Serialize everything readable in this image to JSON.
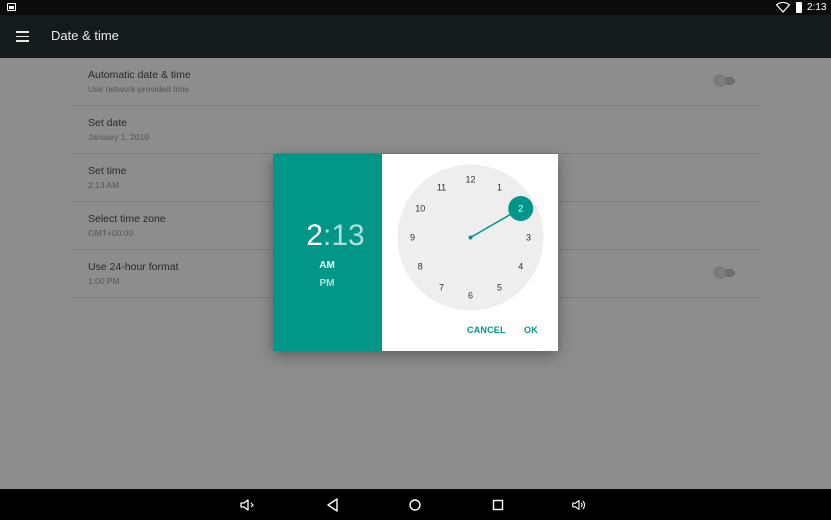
{
  "status_bar": {
    "time": "2:13"
  },
  "app_bar": {
    "title": "Date & time"
  },
  "settings": [
    {
      "title": "Automatic date & time",
      "subtitle": "Use network-provided time",
      "has_toggle": true
    },
    {
      "title": "Set date",
      "subtitle": "January 1, 2010",
      "has_toggle": false
    },
    {
      "title": "Set time",
      "subtitle": "2:13 AM",
      "has_toggle": false
    },
    {
      "title": "Select time zone",
      "subtitle": "GMT+00:00",
      "has_toggle": false
    },
    {
      "title": "Use 24-hour format",
      "subtitle": "1:00 PM",
      "has_toggle": true
    }
  ],
  "time_dialog": {
    "hour": "2",
    "colon": ":",
    "minute": "13",
    "am_label": "AM",
    "pm_label": "PM",
    "selected_period": "AM",
    "clock_numbers": [
      "12",
      "1",
      "2",
      "3",
      "4",
      "5",
      "6",
      "7",
      "8",
      "9",
      "10",
      "11"
    ],
    "selected_hour": "2",
    "cancel_label": "CANCEL",
    "ok_label": "OK"
  },
  "colors": {
    "accent": "#009688",
    "accent_light": "#b2dfdb",
    "dialog_bg": "#ffffff",
    "clock_face": "#eeeeee"
  },
  "nav_bar": {
    "icons": [
      "volume-down-icon",
      "back-icon",
      "home-icon",
      "recents-icon",
      "volume-up-icon"
    ]
  }
}
